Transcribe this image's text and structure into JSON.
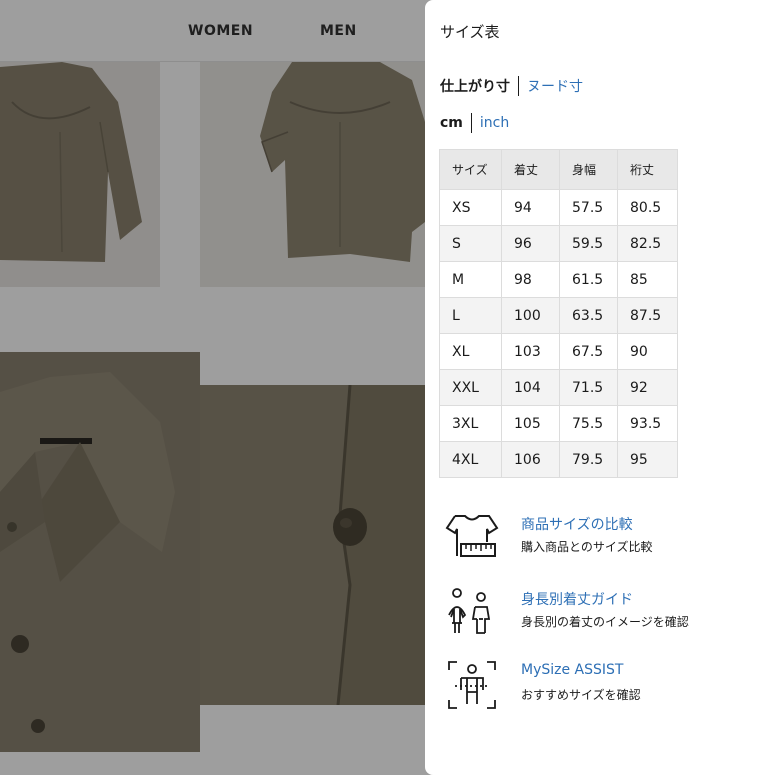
{
  "nav": {
    "women": "WOMEN",
    "men": "MEN"
  },
  "drawer": {
    "title": "サイズ表",
    "fit_toggle": {
      "active": "仕上がり寸",
      "inactive": "ヌード寸"
    },
    "unit_toggle": {
      "active": "cm",
      "inactive": "inch"
    }
  },
  "size_table": {
    "headers": [
      "サイズ",
      "着丈",
      "身幅",
      "裄丈"
    ],
    "rows": [
      [
        "XS",
        "94",
        "57.5",
        "80.5"
      ],
      [
        "S",
        "96",
        "59.5",
        "82.5"
      ],
      [
        "M",
        "98",
        "61.5",
        "85"
      ],
      [
        "L",
        "100",
        "63.5",
        "87.5"
      ],
      [
        "XL",
        "103",
        "67.5",
        "90"
      ],
      [
        "XXL",
        "104",
        "71.5",
        "92"
      ],
      [
        "3XL",
        "105",
        "75.5",
        "93.5"
      ],
      [
        "4XL",
        "106",
        "79.5",
        "95"
      ]
    ]
  },
  "features": [
    {
      "icon": "shirt-measure-icon",
      "title": "商品サイズの比較",
      "subtitle": "購入商品とのサイズ比較"
    },
    {
      "icon": "people-height-icon",
      "title": "身長別着丈ガイド",
      "subtitle": "身長別の着丈のイメージを確認"
    },
    {
      "icon": "body-scan-icon",
      "title": "MySize ASSIST",
      "subtitle": "おすすめサイズを確認"
    }
  ],
  "colors": {
    "link": "#2d6fb5",
    "text": "#1b1b1b",
    "table_header_bg": "#e8e8e8",
    "fabric": "#8b826f",
    "overlay": "rgba(0,0,0,0.38)"
  }
}
